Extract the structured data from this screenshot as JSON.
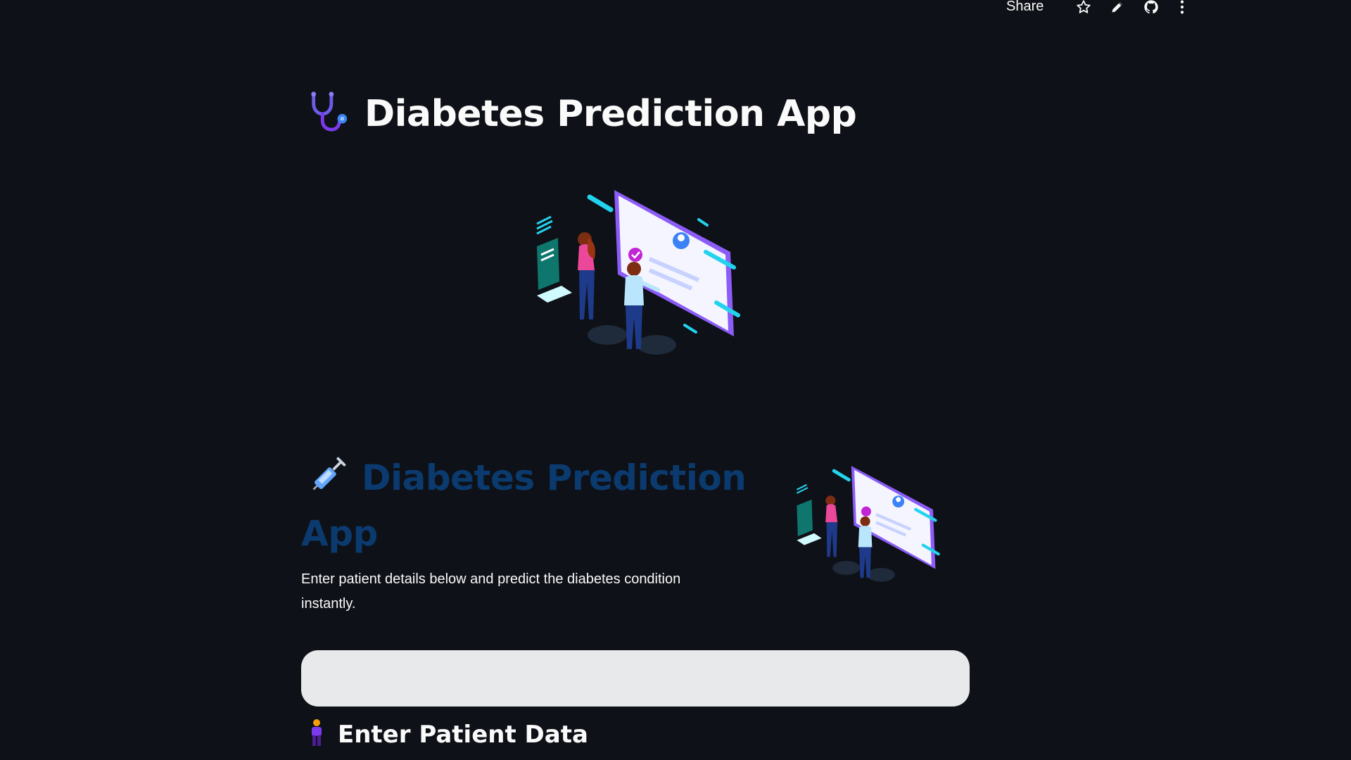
{
  "toolbar": {
    "share_label": "Share",
    "icons": [
      "star-icon",
      "pencil-icon",
      "github-icon",
      "more-vertical-icon"
    ]
  },
  "header": {
    "icon": "stethoscope-icon",
    "title": "Diabetes Prediction App"
  },
  "intro": {
    "icon": "syringe-icon",
    "title": "Diabetes Prediction App",
    "description": "Enter patient details below and predict the diabetes condition instantly."
  },
  "form": {
    "input_value": ""
  },
  "section": {
    "icon": "person-icon",
    "title": "Enter Patient Data"
  },
  "colors": {
    "background": "#0e1117",
    "subtitle_blue": "#0b3a6e",
    "input_bg": "#e8e9ea",
    "accent_purple": "#8b5cf6",
    "accent_cyan": "#22d3ee",
    "accent_pink": "#ec4899"
  }
}
